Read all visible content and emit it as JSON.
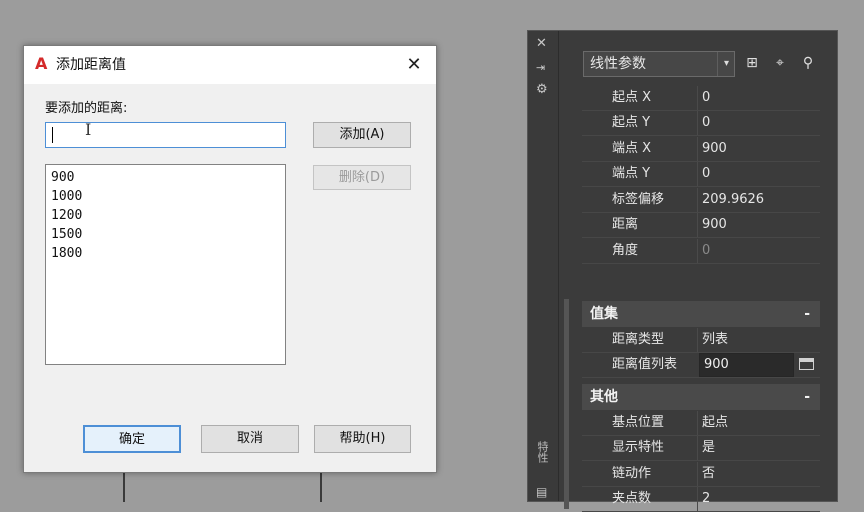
{
  "dialog": {
    "title": "添加距离值",
    "close": "✕",
    "prompt_label": "要添加的距离:",
    "input_value": "",
    "add_button": "添加(A)",
    "delete_button": "删除(D)",
    "list_items": [
      "900",
      "1000",
      "1200",
      "1500",
      "1800"
    ],
    "ok_button": "确定",
    "cancel_button": "取消",
    "help_button": "帮助(H)"
  },
  "palette": {
    "selector": "线性参数",
    "strip_vertical_text": "特性",
    "rows_geometry": [
      {
        "name": "起点 X",
        "value": "0"
      },
      {
        "name": "起点 Y",
        "value": "0"
      },
      {
        "name": "端点 X",
        "value": "900"
      },
      {
        "name": "端点 Y",
        "value": "0"
      },
      {
        "name": "标签偏移",
        "value": "209.9626"
      },
      {
        "name": "距离",
        "value": "900"
      },
      {
        "name": "角度",
        "value": "0"
      }
    ],
    "cat_value_set": {
      "label": "值集",
      "toggle": "-"
    },
    "rows_value_set": [
      {
        "name": "距离类型",
        "value": "列表"
      },
      {
        "name": "距离值列表",
        "value": "900"
      }
    ],
    "cat_misc": {
      "label": "其他",
      "toggle": "-"
    },
    "rows_misc": [
      {
        "name": "基点位置",
        "value": "起点"
      },
      {
        "name": "显示特性",
        "value": "是"
      },
      {
        "name": "链动作",
        "value": "否"
      },
      {
        "name": "夹点数",
        "value": "2"
      }
    ]
  },
  "colors": {
    "accent": "#4d8fd6",
    "logo": "#d42a2a",
    "palette_bg": "#3b3b3b"
  }
}
